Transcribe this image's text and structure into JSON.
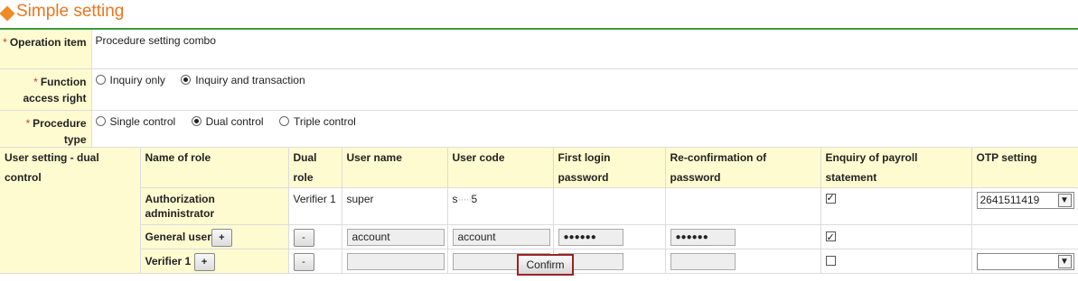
{
  "page": {
    "title": "Simple setting"
  },
  "form": {
    "required_mark": "*",
    "operation_item": {
      "label": "Operation item",
      "value": "Procedure setting combo"
    },
    "function_access": {
      "label": "Function access right",
      "options": [
        {
          "label": "Inquiry only",
          "selected": false
        },
        {
          "label": "Inquiry and transaction",
          "selected": true
        }
      ]
    },
    "procedure_type": {
      "label": "Procedure type",
      "options": [
        {
          "label": "Single control",
          "selected": false
        },
        {
          "label": "Dual control",
          "selected": true
        },
        {
          "label": "Triple control",
          "selected": false
        }
      ]
    }
  },
  "user_setting": {
    "label": "User setting - dual control",
    "headers": [
      "Name of role",
      "Dual role",
      "User name",
      "User code",
      "First login password",
      "Re-confirmation of password",
      "Enquiry of payroll statement",
      "OTP setting"
    ],
    "rows": [
      {
        "role": "Authorization administrator",
        "dual_role": "Verifier 1",
        "user_name": "super",
        "user_code_prefix": "s",
        "user_code_masked": "·····",
        "user_code_suffix": "5",
        "payroll_enquiry": true,
        "otp": "2641511419"
      },
      {
        "role": "General user",
        "add_button": "+",
        "remove_button": "-",
        "user_name": "account",
        "user_code": "account",
        "password": "●●●●●●",
        "password_confirm": "●●●●●●",
        "payroll_enquiry": true
      },
      {
        "role": "Verifier 1",
        "add_button": "+",
        "remove_button": "-",
        "user_name": "",
        "user_code": "",
        "password": "",
        "password_confirm": "",
        "payroll_enquiry": false,
        "otp": ""
      }
    ],
    "select_arrow": "chevron-down-icon"
  },
  "actions": {
    "confirm": "Confirm"
  },
  "colors": {
    "title": "#e8761e",
    "label_bg": "#fffbd0",
    "title_line": "#3d9a3d",
    "required": "#e03030",
    "confirm_border": "#9c2222"
  }
}
